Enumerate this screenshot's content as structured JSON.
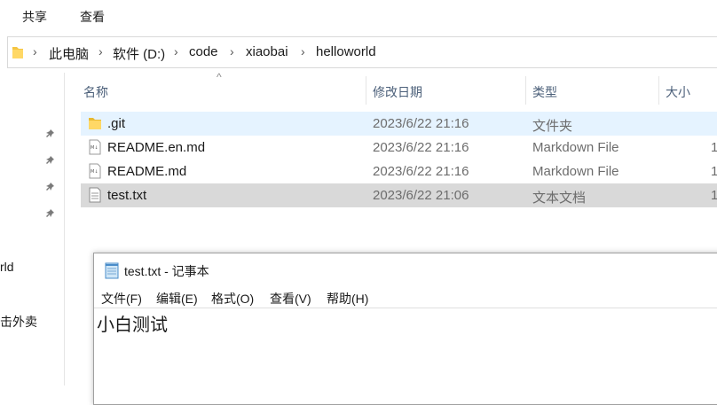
{
  "ribbon": {
    "tabs": [
      "共享",
      "查看"
    ]
  },
  "address": {
    "crumbs": [
      "此电脑",
      "软件 (D:)",
      "code",
      "xiaobai",
      "helloworld"
    ]
  },
  "navpane": {
    "items": [
      "rld",
      "击外卖"
    ]
  },
  "columns": {
    "name": "名称",
    "date": "修改日期",
    "type": "类型",
    "size": "大小",
    "sort_indicator": "^"
  },
  "files": [
    {
      "name": ".git",
      "date": "2023/6/22 21:16",
      "type": "文件夹",
      "size": "",
      "icon": "folder-icon"
    },
    {
      "name": "README.en.md",
      "date": "2023/6/22 21:16",
      "type": "Markdown File",
      "size": "1",
      "icon": "markdown-file-icon"
    },
    {
      "name": "README.md",
      "date": "2023/6/22 21:16",
      "type": "Markdown File",
      "size": "1",
      "icon": "markdown-file-icon"
    },
    {
      "name": "test.txt",
      "date": "2023/6/22 21:06",
      "type": "文本文档",
      "size": "1",
      "icon": "text-file-icon"
    }
  ],
  "notepad": {
    "title": "test.txt - 记事本",
    "menu": [
      "文件(F)",
      "编辑(E)",
      "格式(O)",
      "查看(V)",
      "帮助(H)"
    ],
    "content": "小白测试"
  }
}
